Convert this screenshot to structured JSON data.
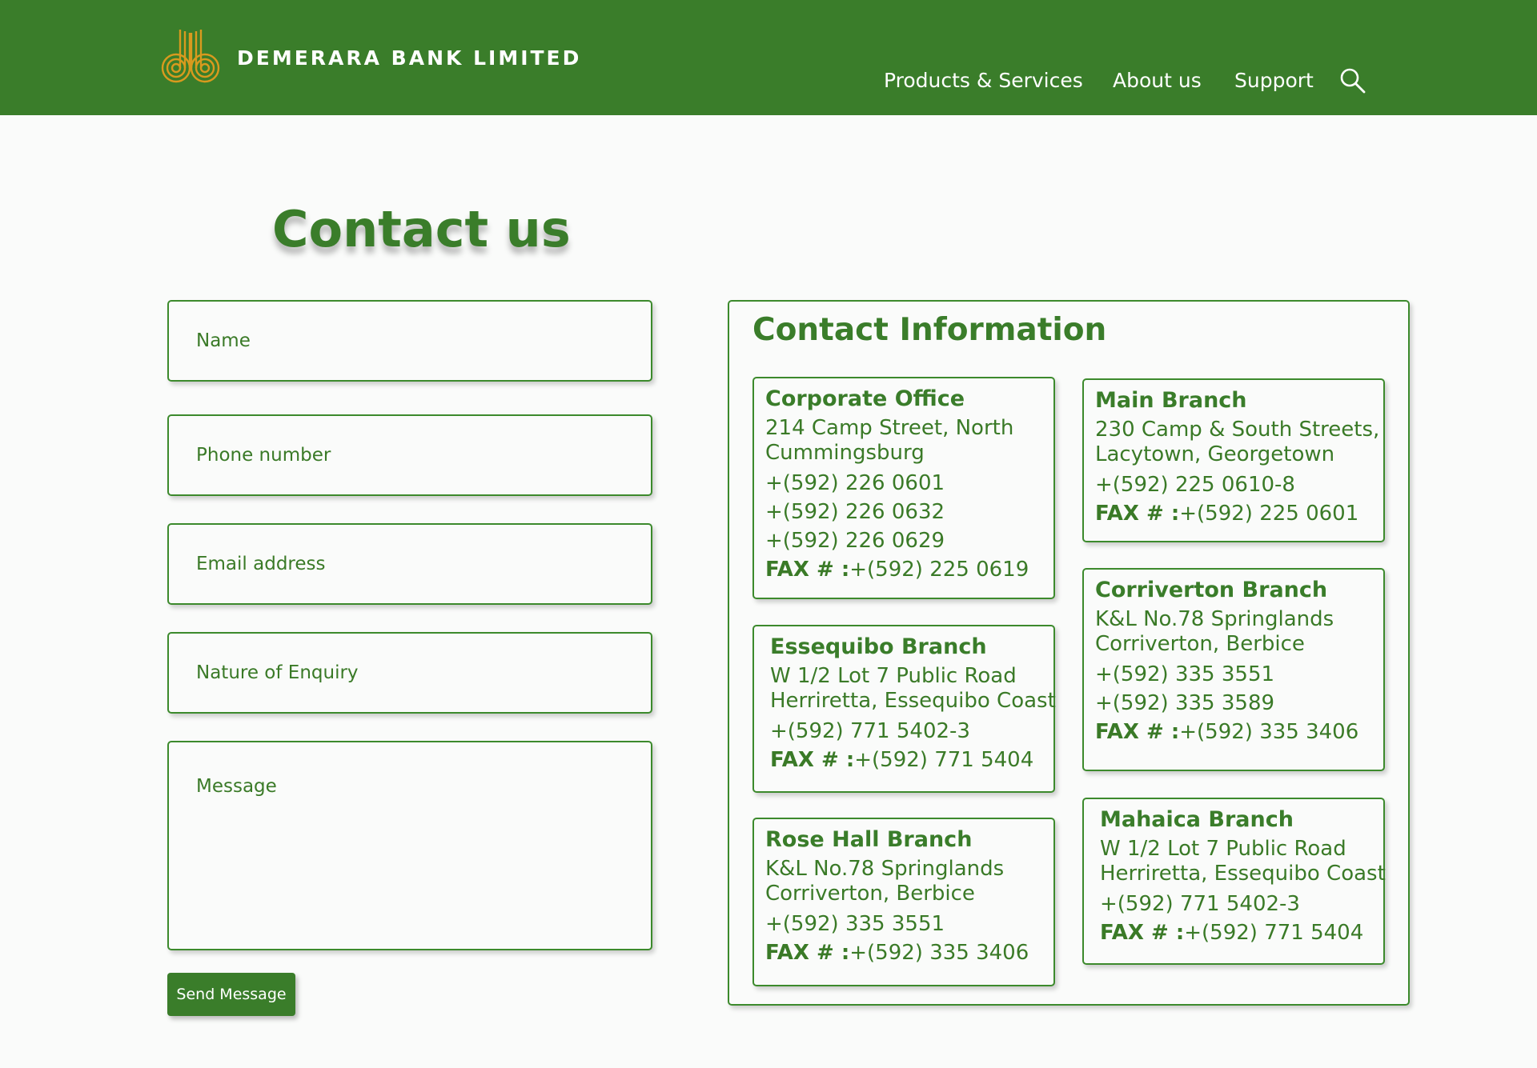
{
  "header": {
    "brand": "DEMERARA BANK LIMITED",
    "nav": [
      "Products & Services",
      "About us",
      "Support"
    ],
    "search_icon": "search-icon",
    "logo_icon": "db-logo",
    "bg_color": "#3a7d2a",
    "logo_color": "#d99a1e"
  },
  "page": {
    "title": "Contact us"
  },
  "form": {
    "name_placeholder": "Name",
    "phone_placeholder": "Phone number",
    "email_placeholder": "Email address",
    "nature_placeholder": "Nature of Enquiry",
    "message_placeholder": "Message",
    "send_label": "Send Message"
  },
  "contact": {
    "title": "Contact Information",
    "fax_label": "FAX # :",
    "branches": [
      {
        "name": "Corporate Office",
        "address": [
          "214 Camp Street, North",
          "Cummingsburg"
        ],
        "phones": [
          "+(592) 226 0601",
          "+(592) 226 0632",
          "+(592) 226 0629"
        ],
        "fax": "+(592) 225 0619"
      },
      {
        "name": "Main Branch",
        "address": [
          "230 Camp & South Streets,",
          "Lacytown, Georgetown"
        ],
        "phones": [
          "+(592) 225 0610-8"
        ],
        "fax": "+(592) 225 0601"
      },
      {
        "name": "Essequibo Branch",
        "address": [
          "W 1/2 Lot 7 Public Road",
          "Herriretta, Essequibo Coast"
        ],
        "phones": [
          "+(592) 771 5402-3"
        ],
        "fax": "+(592) 771 5404"
      },
      {
        "name": "Corriverton Branch",
        "address": [
          "K&L No.78 Springlands",
          "Corriverton, Berbice"
        ],
        "phones": [
          "+(592) 335 3551",
          "+(592) 335 3589"
        ],
        "fax": "+(592) 335 3406"
      },
      {
        "name": "Rose Hall Branch",
        "address": [
          "K&L No.78 Springlands",
          "Corriverton, Berbice"
        ],
        "phones": [
          "+(592) 335 3551"
        ],
        "fax": "+(592) 335 3406"
      },
      {
        "name": "Mahaica Branch",
        "address": [
          "W 1/2 Lot 7 Public Road",
          "Herriretta, Essequibo Coast"
        ],
        "phones": [
          "+(592) 771 5402-3"
        ],
        "fax": "+(592) 771 5404"
      }
    ]
  }
}
